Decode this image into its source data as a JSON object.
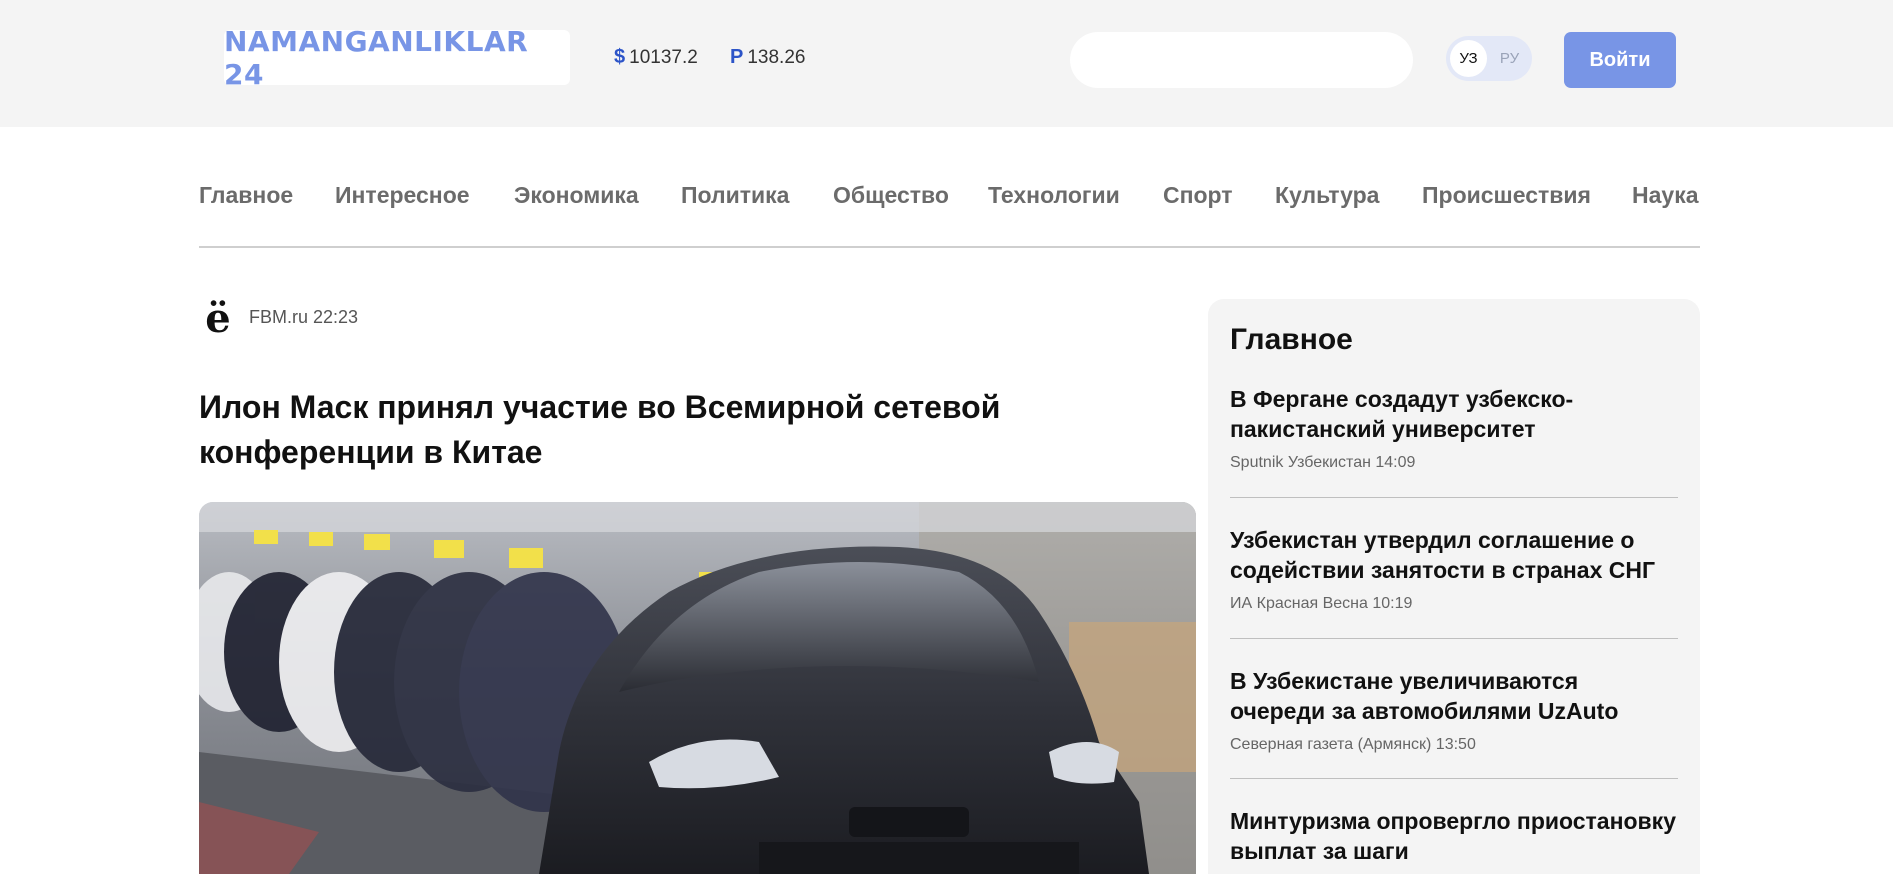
{
  "header": {
    "logo": "NAMANGANLIKLAR 24",
    "rates": [
      {
        "symbol": "$",
        "value": "10137.2"
      },
      {
        "symbol": "P",
        "value": "138.26"
      }
    ],
    "search_placeholder": "",
    "lang": {
      "uz": "УЗ",
      "ru": "РУ",
      "active": "УЗ"
    },
    "login_label": "Войти"
  },
  "nav": {
    "items": [
      "Главное",
      "Интересное",
      "Экономика",
      "Политика",
      "Общество",
      "Технологии",
      "Спорт",
      "Культура",
      "Происшествия",
      "Наука"
    ]
  },
  "article": {
    "source": "FBM.ru 22:23",
    "source_icon": "ё",
    "title": "Илон Маск принял участие во Всемирной сетевой конференции в Китае"
  },
  "sidebar": {
    "title": "Главное",
    "news": [
      {
        "title": "В Фергане создадут узбекско-пакистанский университет",
        "meta": "Sputnik Узбекистан 14:09"
      },
      {
        "title": "Узбекистан утвердил соглашение о содействии занятости в странах СНГ",
        "meta": "ИА Красная Весна 10:19"
      },
      {
        "title": "В Узбекистане увеличиваются очереди за автомобилями UzAuto",
        "meta": "Северная газета (Армянск) 13:50"
      },
      {
        "title": "Минтуризма опровергло приостановку выплат за шаги",
        "meta": ""
      }
    ]
  },
  "colors": {
    "accent": "#7895e6",
    "rate_symbol": "#2c54c8",
    "header_bg": "#f4f4f4"
  }
}
